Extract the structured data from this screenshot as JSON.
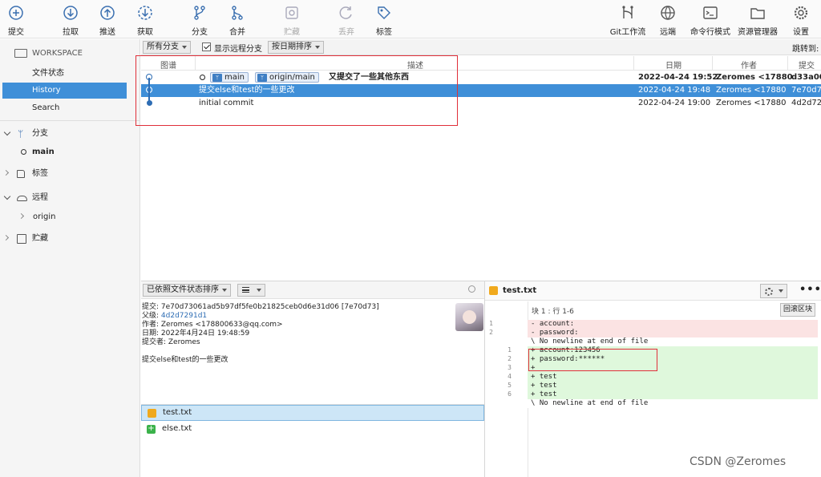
{
  "toolbar": {
    "commit": "提交",
    "pull": "拉取",
    "push": "推送",
    "fetch": "获取",
    "branch": "分支",
    "merge": "合并",
    "stash": "贮藏",
    "discard": "丢弃",
    "tag": "标签",
    "git_flow": "Git工作流",
    "remote": "远端",
    "terminal": "命令行模式",
    "explorer": "资源管理器",
    "settings": "设置"
  },
  "sidebar": {
    "workspace": "WORKSPACE",
    "file_status": "文件状态",
    "history": "History",
    "search": "Search",
    "branches": "分支",
    "branch_main": "main",
    "tags": "标签",
    "remotes": "远程",
    "remote_origin": "origin",
    "stashes": "贮藏"
  },
  "filter_bar": {
    "all_branches": "所有分支",
    "show_remote": "显示远程分支",
    "sort_by_date": "按日期排序",
    "jump_to": "跳转到:"
  },
  "columns": {
    "graph": "图谱",
    "desc": "描述",
    "date": "日期",
    "author": "作者",
    "commit": "提交"
  },
  "commits": [
    {
      "tags": [
        "main",
        "origin/main"
      ],
      "desc": "又提交了一些其他东西",
      "date": "2022-04-24 19:52",
      "author": "Zeromes <17880",
      "hash": "d33a00"
    },
    {
      "tags": [],
      "desc": "提交else和test的一些更改",
      "date": "2022-04-24 19:48",
      "author": "Zeromes <17880",
      "hash": "7e70d7"
    },
    {
      "tags": [],
      "desc": "initial commit",
      "date": "2022-04-24 19:00",
      "author": "Zeromes <17880",
      "hash": "4d2d72"
    }
  ],
  "details": {
    "sort_label": "已依照文件状态排序",
    "commit_line": "提交: 7e70d73061ad5b97df5fe0b21825ceb0d6e31d06 [7e70d73]",
    "parent_label": "父级:",
    "parent_hash": "4d2d7291d1",
    "author_line": "作者: Zeromes <178800633@qq.com>",
    "date_line": "日期: 2022年4月24日 19:48:59",
    "committer_line": "提交者: Zeromes",
    "message": "提交else和test的一些更改"
  },
  "files": [
    {
      "name": "test.txt",
      "status": "modified"
    },
    {
      "name": "else.txt",
      "status": "added"
    }
  ],
  "diff": {
    "filename": "test.txt",
    "hunk": "块 1 : 行 1-6",
    "revert_hunk": "回滚区块",
    "lines": [
      {
        "old": "1",
        "new": "",
        "type": "del",
        "text": "- account:"
      },
      {
        "old": "2",
        "new": "",
        "type": "del",
        "text": "- password:"
      },
      {
        "old": "",
        "new": "",
        "type": "ctx",
        "text": "\\ No newline at end of file"
      },
      {
        "old": "",
        "new": "1",
        "type": "add",
        "text": "+ account:123456"
      },
      {
        "old": "",
        "new": "2",
        "type": "add",
        "text": "+ password:******"
      },
      {
        "old": "",
        "new": "3",
        "type": "add",
        "text": "+"
      },
      {
        "old": "",
        "new": "4",
        "type": "add",
        "text": "+ test"
      },
      {
        "old": "",
        "new": "5",
        "type": "add",
        "text": "+ test"
      },
      {
        "old": "",
        "new": "6",
        "type": "add",
        "text": "+ test"
      },
      {
        "old": "",
        "new": "",
        "type": "ctx",
        "text": "\\ No newline at end of file"
      }
    ]
  },
  "watermark": "CSDN @Zeromes",
  "colors": {
    "accent": "#3f8fd8",
    "annotation": "#e0303a",
    "diff_del": "#fbe3e3",
    "diff_add": "#dff8dc"
  }
}
